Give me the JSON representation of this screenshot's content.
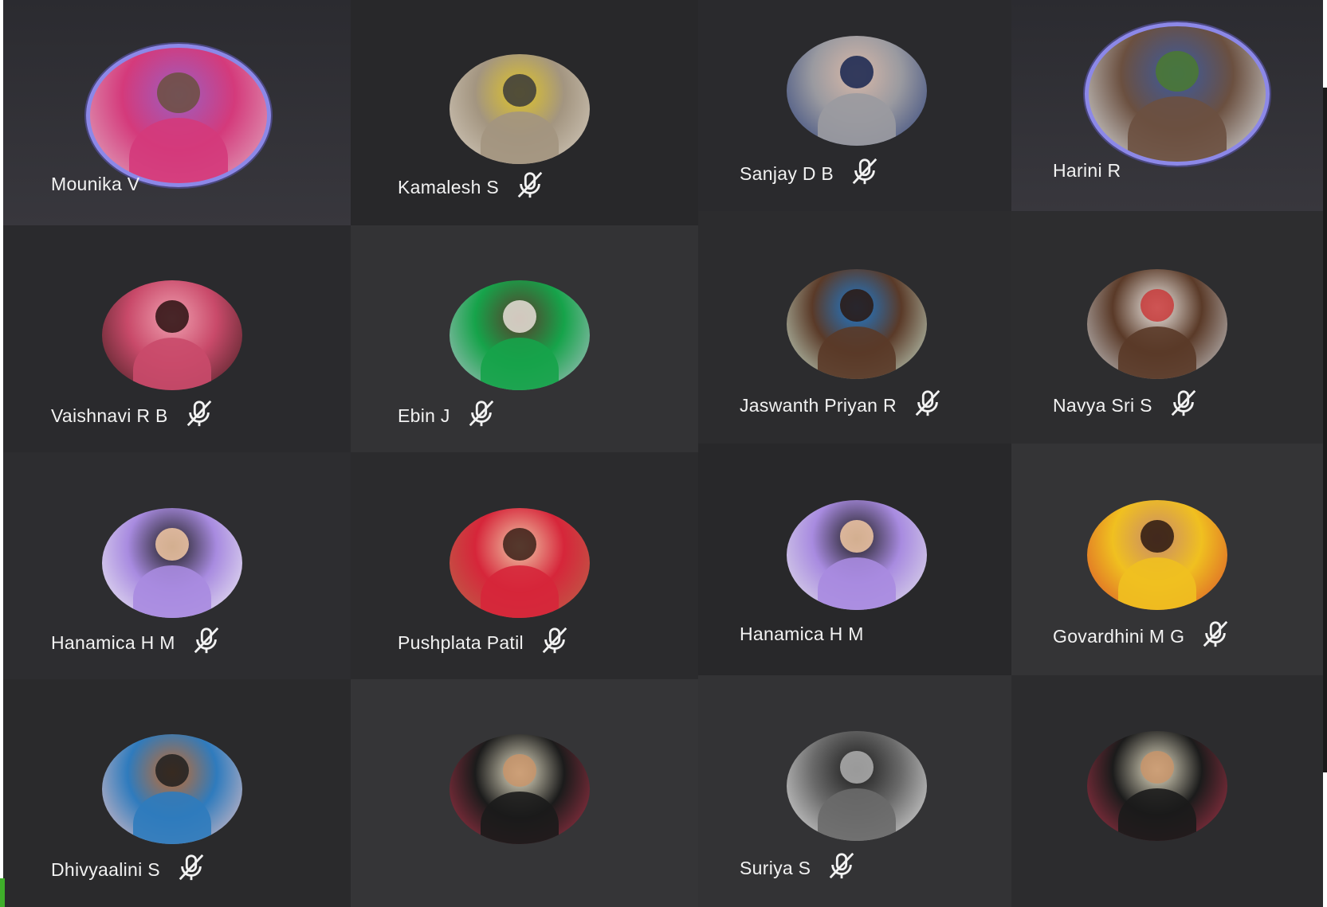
{
  "meeting": {
    "participants": [
      {
        "name": "Mounika V",
        "muted": false,
        "speaking": true,
        "avatar_colors": [
          "#e2b7c8",
          "#d43a7b",
          "#9b5ec1",
          "#6b5040"
        ]
      },
      {
        "name": "Vaishnavi R B",
        "muted": true,
        "speaking": false,
        "avatar_colors": [
          "#3a1c1c",
          "#c94a6a",
          "#f0a0b0",
          "#2a1010"
        ]
      },
      {
        "name": "Hanamica H M",
        "muted": true,
        "speaking": false,
        "avatar_colors": [
          "#f4f4f4",
          "#a88be0",
          "#1b1b1b",
          "#f3c9a5"
        ]
      },
      {
        "name": "Dhivyaalini S",
        "muted": true,
        "speaking": false,
        "avatar_colors": [
          "#f1c6c6",
          "#2f7bbd",
          "#c46a2c",
          "#1e1e1e"
        ]
      },
      {
        "name": "Kamalesh S",
        "muted": true,
        "speaking": false,
        "avatar_colors": [
          "#d8cfc2",
          "#a39580",
          "#e0c428",
          "#3a3a3a"
        ]
      },
      {
        "name": "Ebin J",
        "muted": true,
        "speaking": false,
        "avatar_colors": [
          "#b8c4d0",
          "#16a34a",
          "#5a3a2a",
          "#e8e0d8"
        ]
      },
      {
        "name": "Pushplata Patil",
        "muted": true,
        "speaking": false,
        "avatar_colors": [
          "#b86a4a",
          "#d6263a",
          "#f0c8a8",
          "#3a2018"
        ]
      },
      {
        "name": "",
        "muted": false,
        "speaking": false,
        "avatar_colors": [
          "#b3354b",
          "#1b1b1b",
          "#e8e2c8",
          "#c8946a"
        ]
      },
      {
        "name": "Sanjay D B",
        "muted": true,
        "speaking": false,
        "avatar_colors": [
          "#2b3f7a",
          "#9a9aa0",
          "#d8b8a8",
          "#16244f"
        ]
      },
      {
        "name": "Jaswanth Priyan R",
        "muted": true,
        "speaking": false,
        "avatar_colors": [
          "#cfe8d4",
          "#5a3a28",
          "#1d7ad0",
          "#2a1810"
        ]
      },
      {
        "name": "Hanamica H M",
        "muted": false,
        "speaking": false,
        "avatar_colors": [
          "#e6e6ea",
          "#a88be0",
          "#1b1b1b",
          "#f3c9a5"
        ]
      },
      {
        "name": "Suriya S",
        "muted": true,
        "speaking": false,
        "avatar_colors": [
          "#e8e8e8",
          "#6a6a6a",
          "#1a1a1a",
          "#b0b0b0"
        ]
      },
      {
        "name": "Harini R",
        "muted": false,
        "speaking": true,
        "avatar_colors": [
          "#e6eef2",
          "#6b5040",
          "#3b5aa0",
          "#4a7a30"
        ]
      },
      {
        "name": "Navya Sri S",
        "muted": true,
        "speaking": false,
        "avatar_colors": [
          "#d0d4d8",
          "#5a3a28",
          "#f0ece8",
          "#c83a3a"
        ]
      },
      {
        "name": "Govardhini M G",
        "muted": true,
        "speaking": false,
        "avatar_colors": [
          "#d84a2a",
          "#f0c020",
          "#c88a6a",
          "#2a1810"
        ]
      },
      {
        "name": "",
        "muted": false,
        "speaking": false,
        "avatar_colors": [
          "#b3354b",
          "#1b1b1b",
          "#e8e2c8",
          "#c8946a"
        ]
      }
    ]
  }
}
